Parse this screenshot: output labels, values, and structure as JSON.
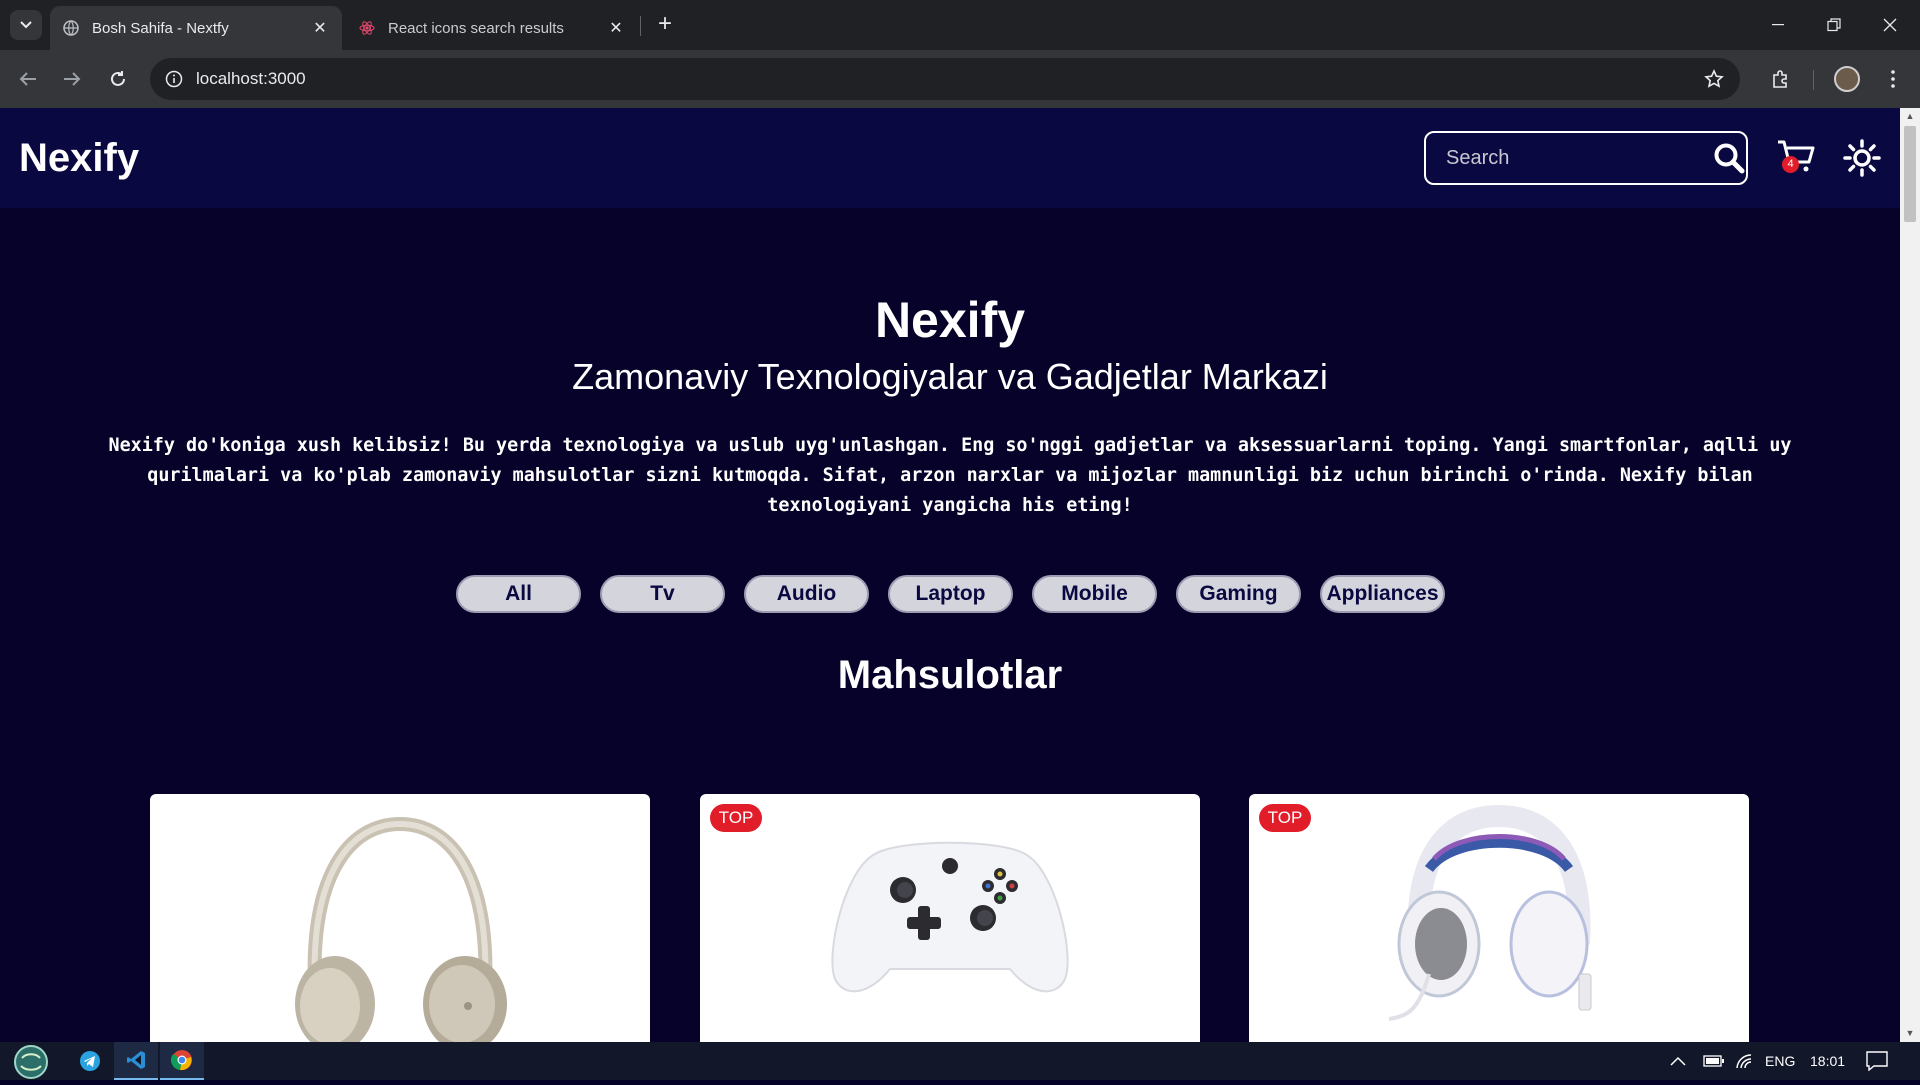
{
  "browser": {
    "tabs": [
      {
        "title": "Bosh Sahifa - Nextfy",
        "active": true
      },
      {
        "title": "React icons search results",
        "active": false
      }
    ],
    "url": "localhost:3000"
  },
  "header": {
    "logo": "Nexify",
    "search_placeholder": "Search",
    "cart_count": "4"
  },
  "hero": {
    "title": "Nexify",
    "subtitle": "Zamonaviy Texnologiyalar va Gadjetlar Markazi",
    "description": "Nexify do'koniga xush kelibsiz! Bu yerda texnologiya va uslub uyg'unlashgan. Eng so'nggi gadjetlar va aksessuarlarni toping. Yangi smartfonlar, aqlli uy qurilmalari va ko'plab zamonaviy mahsulotlar sizni kutmoqda. Sifat, arzon narxlar va mijozlar mamnunligi biz uchun birinchi o'rinda. Nexify bilan texnologiyani yangicha his eting!"
  },
  "categories": [
    "All",
    "Tv",
    "Audio",
    "Laptop",
    "Mobile",
    "Gaming",
    "Appliances"
  ],
  "products_title": "Mahsulotlar",
  "products": [
    {
      "badge": "",
      "image": "headphones"
    },
    {
      "badge": "TOP",
      "image": "game-controller"
    },
    {
      "badge": "TOP",
      "image": "gaming-headset"
    }
  ],
  "taskbar": {
    "lang": "ENG",
    "time": "18:01"
  }
}
